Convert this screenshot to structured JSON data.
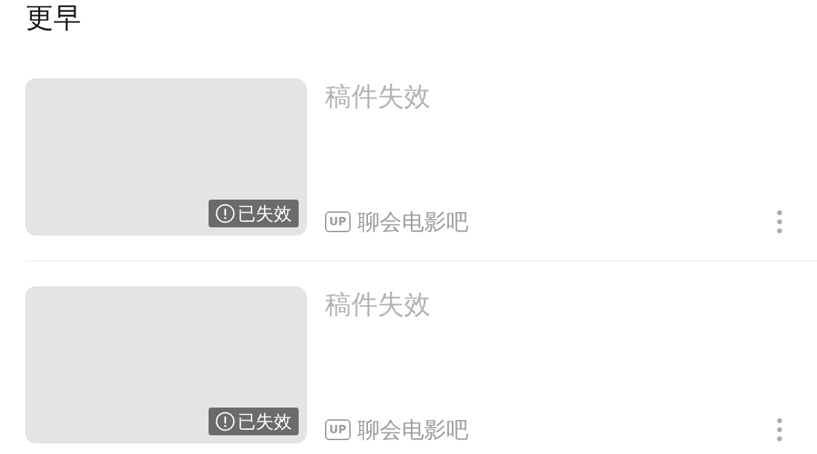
{
  "section_title": "更早",
  "items": [
    {
      "title": "稿件失效",
      "status": "已失效",
      "up_badge": "UP",
      "uploader": "聊会电影吧",
      "invalid": true
    },
    {
      "title": "稿件失效",
      "status": "已失效",
      "up_badge": "UP",
      "uploader": "聊会电影吧",
      "invalid": true
    }
  ]
}
